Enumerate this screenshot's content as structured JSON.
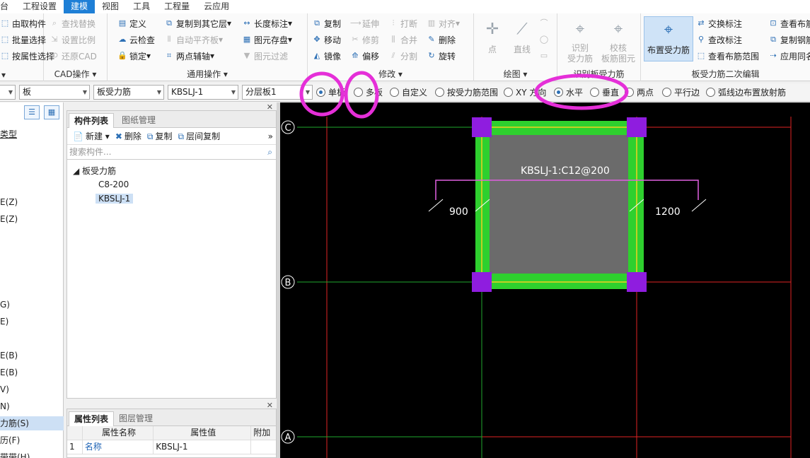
{
  "menu": {
    "items": [
      {
        "label": "台",
        "active": false
      },
      {
        "label": "工程设置",
        "active": false
      },
      {
        "label": "建模",
        "active": true
      },
      {
        "label": "视图",
        "active": false
      },
      {
        "label": "工具",
        "active": false
      },
      {
        "label": "工程量",
        "active": false
      },
      {
        "label": "云应用",
        "active": false
      }
    ]
  },
  "ribbon": {
    "select_group": {
      "title": "",
      "rows": [
        "由取构件",
        "批量选择",
        "按属性选择"
      ]
    },
    "cad_group": {
      "title": "CAD操作",
      "rows": [
        "查找替换",
        "设置比例",
        "还原CAD"
      ]
    },
    "common_group": {
      "title": "通用操作",
      "col1": [
        "定义",
        "云检查",
        "锁定"
      ],
      "col2": [
        "复制到其它层",
        "自动平齐板",
        "两点辅轴"
      ],
      "col3": [
        "长度标注",
        "图元存盘",
        "图元过滤"
      ]
    },
    "modify_group": {
      "title": "修改",
      "col1": [
        "复制",
        "移动",
        "镜像"
      ],
      "col2": [
        "延伸",
        "修剪",
        "偏移"
      ],
      "col3": [
        "打断",
        "合并",
        "分割"
      ],
      "col4": [
        "对齐",
        "删除",
        "旋转"
      ]
    },
    "draw_group": {
      "title": "绘图",
      "point_label": "点",
      "line_label": "直线"
    },
    "identify_group": {
      "title": "识别板受力筋",
      "identify_label": "识别\n受力筋",
      "check_label": "校核\n板筋图元"
    },
    "edit_group": {
      "title": "板受力筋二次编辑",
      "place_label": "布置受力筋",
      "col1": [
        "交换标注",
        "查改标注",
        "查看布筋范围"
      ],
      "col2": [
        "查看布筋",
        "复制钢筋",
        "应用同名"
      ]
    }
  },
  "toolbar2": {
    "combo_1": "",
    "combo_2": "板",
    "combo_3": "板受力筋",
    "combo_4": "KBSLJ-1",
    "combo_5": "分层板1",
    "radios": [
      {
        "label": "单板",
        "on": true
      },
      {
        "label": "多板",
        "on": false
      },
      {
        "label": "自定义",
        "on": false
      },
      {
        "label": "按受力筋范围",
        "on": false
      },
      {
        "label": "XY 方向",
        "on": false
      },
      {
        "label": "水平",
        "on": true
      },
      {
        "label": "垂直",
        "on": false
      },
      {
        "label": "两点",
        "on": false
      },
      {
        "label": "平行边",
        "on": false
      },
      {
        "label": "弧线边布置放射筋",
        "on": false
      }
    ]
  },
  "leftnav": {
    "items": [
      {
        "label": "类型",
        "sel": false
      },
      {
        "label": "E(Z)",
        "sel": false
      },
      {
        "label": "E(Z)",
        "sel": false
      },
      {
        "label": "G)",
        "sel": false
      },
      {
        "label": "E)",
        "sel": false
      },
      {
        "label": "E(B)",
        "sel": false
      },
      {
        "label": "E(B)",
        "sel": false
      },
      {
        "label": "V)",
        "sel": false
      },
      {
        "label": "N)",
        "sel": false
      },
      {
        "label": "力筋(S)",
        "sel": true
      },
      {
        "label": "历(F)",
        "sel": false
      },
      {
        "label": "带带(H)",
        "sel": false
      }
    ]
  },
  "component_panel": {
    "tab_components": "构件列表",
    "tab_drawings": "图纸管理",
    "tools": {
      "new": "新建",
      "delete": "删除",
      "copy": "复制",
      "floor_copy": "层间复制"
    },
    "search_placeholder": "搜索构件...",
    "tree_root": "板受力筋",
    "tree_children": [
      {
        "label": "C8-200",
        "sel": false
      },
      {
        "label": "KBSLJ-1",
        "sel": true
      }
    ]
  },
  "property_panel": {
    "tab_props": "属性列表",
    "tab_layers": "图层管理",
    "headers": {
      "name": "属性名称",
      "value": "属性值",
      "extra": "附加"
    },
    "rows": [
      {
        "index": "1",
        "name": "名称",
        "value": "KBSLJ-1"
      }
    ]
  },
  "canvas": {
    "axis_labels": [
      "C",
      "B",
      "A"
    ],
    "rebar_label": "KBSLJ-1:C12@200",
    "dim_left": "900",
    "dim_right": "1200",
    "colors": {
      "background": "#000000",
      "grid_red": "#e02424",
      "grid_green": "#1fa82e",
      "slab_fill": "#6b6b6b",
      "beam_green": "#2ed02e",
      "column_purple": "#8f1ddf",
      "rebar_pink": "#e060e0",
      "slab_edge_yellow": "#f0d020",
      "annotation_circle": "#e52fd8"
    }
  }
}
